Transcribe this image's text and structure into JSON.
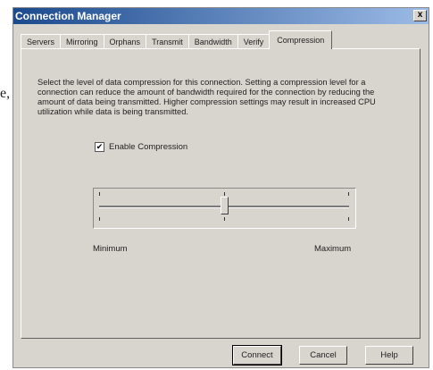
{
  "stray_text": "e,",
  "window": {
    "title": "Connection Manager",
    "close_label": "x"
  },
  "tabs": [
    {
      "label": "Servers",
      "active": false
    },
    {
      "label": "Mirroring",
      "active": false
    },
    {
      "label": "Orphans",
      "active": false
    },
    {
      "label": "Transmit",
      "active": false
    },
    {
      "label": "Bandwidth",
      "active": false
    },
    {
      "label": "Verify",
      "active": false
    },
    {
      "label": "Compression",
      "active": true
    }
  ],
  "compression": {
    "description": "Select the level of data compression for this connection.  Setting a compression level for a connection can reduce the amount of bandwidth required for the connection by reducing the amount of data being transmitted. Higher compression settings may result in increased CPU utilization while data is being transmitted.",
    "checkbox_label": "Enable Compression",
    "checkbox_checked": true,
    "checkbox_glyph": "✔",
    "slider_min_label": "Minimum",
    "slider_max_label": "Maximum",
    "slider_value_fraction": 0.5
  },
  "buttons": {
    "connect": "Connect",
    "cancel": "Cancel",
    "help": "Help"
  },
  "colors": {
    "title_gradient_start": "#1c4a8e",
    "title_gradient_end": "#9cbbe6",
    "dialog_bg": "#d8d5ce"
  }
}
